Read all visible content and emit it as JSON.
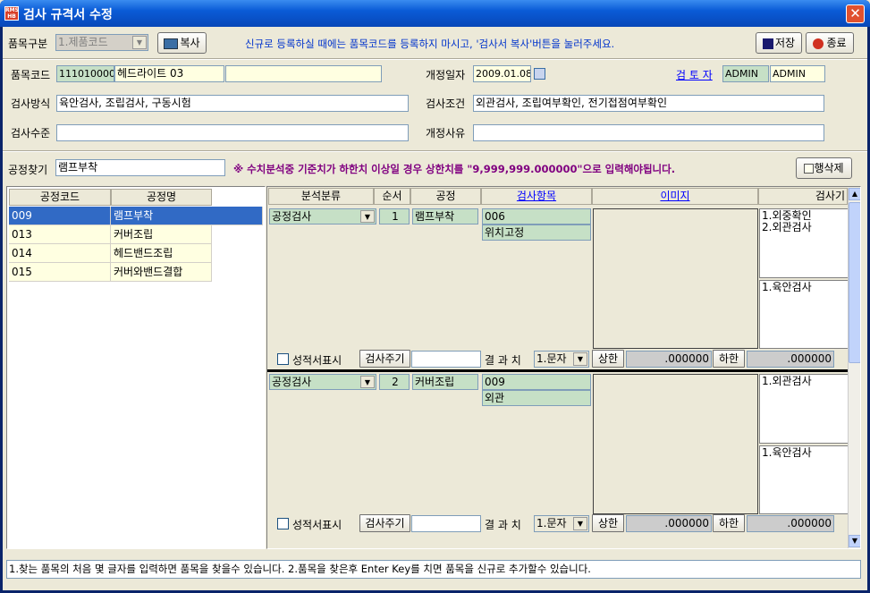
{
  "window": {
    "title": "검사 규격서 수정",
    "app_icon_text": "RMS HB"
  },
  "toolbar": {
    "item_type_label": "품목구분",
    "item_type_value": "1.제품코드",
    "copy_button": "복사",
    "notice": "신규로 등록하실 때에는 품목코드를 등록하지 마시고, '검사서 복사'버튼을 눌러주세요.",
    "save_button": "저장",
    "exit_button": "종료"
  },
  "form": {
    "item_code_label": "품목코드",
    "item_code": "1110100007",
    "item_name": "헤드라이트 03",
    "item_extra": "",
    "revision_date_label": "개정일자",
    "revision_date": "2009.01.08",
    "reviewer_label": "검 토 자",
    "reviewer_id": "ADMIN",
    "reviewer_name": "ADMIN",
    "method_label": "검사방식",
    "method_value": "육안검사, 조립검사, 구동시험",
    "condition_label": "검사조건",
    "condition_value": "외관검사, 조립여부확인, 전기접점여부확인",
    "level_label": "검사수준",
    "level_value": "",
    "reason_label": "개정사유",
    "reason_value": ""
  },
  "search": {
    "label": "공정찾기",
    "value": "램프부착",
    "warning": "※ 수치분석중 기준치가 하한치 이상일 경우 상한치를 \"9,999,999.000000\"으로 입력해야됩니다.",
    "delete_row_button": "행삭제"
  },
  "process_table": {
    "headers": [
      "공정코드",
      "공정명"
    ],
    "rows": [
      {
        "code": "009",
        "name": "램프부착"
      },
      {
        "code": "013",
        "name": "커버조립"
      },
      {
        "code": "014",
        "name": "헤드밴드조립"
      },
      {
        "code": "015",
        "name": "커버와밴드결합"
      }
    ]
  },
  "spec_grid": {
    "headers": {
      "category": "분석분류",
      "seq": "순서",
      "process": "공정",
      "item": "검사항목",
      "image": "이미지",
      "method": "검사기"
    },
    "labels": {
      "report": "성적서표시",
      "cycle": "검사주기",
      "result": "결 과 치",
      "upper": "상한",
      "lower": "하한"
    },
    "rows": [
      {
        "category": "공정검사",
        "seq": "1",
        "process": "램프부착",
        "item_code": "006",
        "item_name": "위치고정",
        "method_1": "1.외중확인\n2.외관검사",
        "method_2": "1.육안검사",
        "cycle": "",
        "result_type": "1.문자",
        "upper": ".000000",
        "lower": ".000000"
      },
      {
        "category": "공정검사",
        "seq": "2",
        "process": "커버조립",
        "item_code": "009",
        "item_name": "외관",
        "method_1": "1.외관검사",
        "method_2": "1.육안검사",
        "cycle": "",
        "result_type": "1.문자",
        "upper": ".000000",
        "lower": ".000000"
      }
    ]
  },
  "status": {
    "text": "1.찾는 품목의 처음 몇 글자를 입력하면 품목을 찾을수 있습니다. 2.품목을 찾은후 Enter Key를 치면 품목을 신규로 추가할수 있습니다."
  },
  "colors": {
    "title_bar": "#0a5bd6",
    "highlight": "#316ac5",
    "notice_text": "#0033cc",
    "warning_text": "#800080"
  }
}
